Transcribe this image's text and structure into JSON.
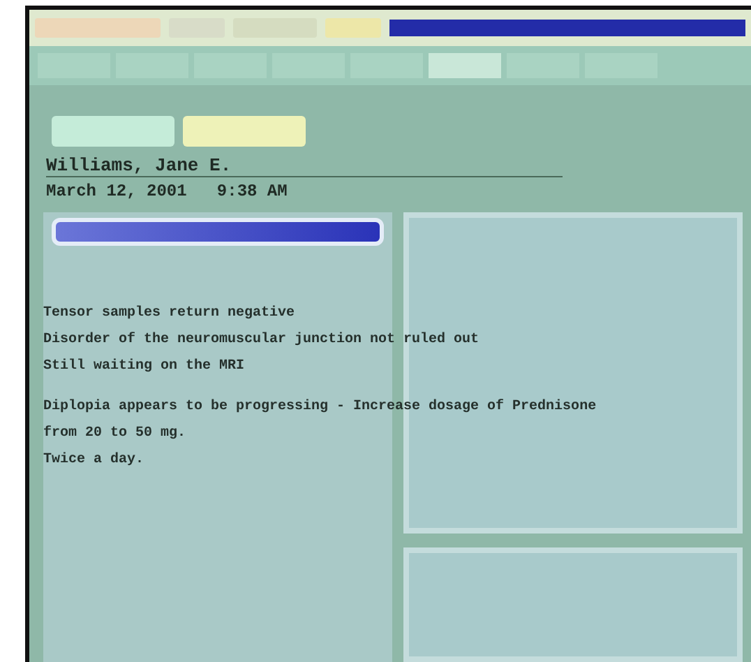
{
  "patient": {
    "name": "Williams, Jane E.",
    "visit_time": "March 12, 2001   9:38 AM"
  },
  "note_paragraphs": [
    [
      "Tensor samples return negative",
      "Disorder of the neuromuscular junction not ruled out",
      "Still waiting on the MRI"
    ],
    [
      "Diplopia appears to be progressing - Increase dosage of Prednisone",
      "from 20 to 50 mg.",
      "Twice a day."
    ]
  ]
}
